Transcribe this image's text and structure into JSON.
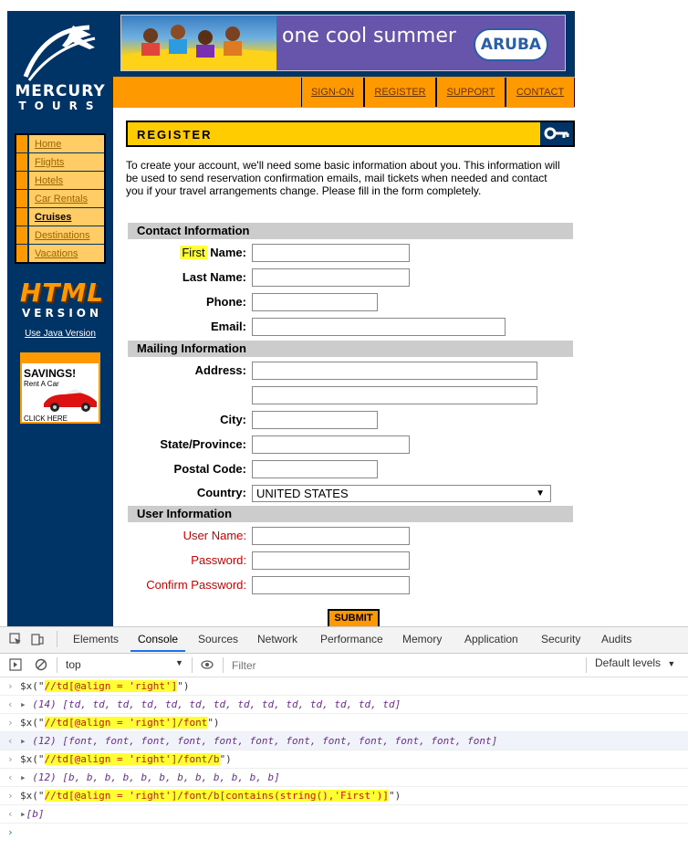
{
  "page": {
    "logo": {
      "line1": "MERCURY",
      "line2": "TOURS"
    },
    "sidebar_nav": [
      {
        "label": "Home",
        "active": false
      },
      {
        "label": "Flights",
        "active": false
      },
      {
        "label": "Hotels",
        "active": false
      },
      {
        "label": "Car Rentals",
        "active": false
      },
      {
        "label": "Cruises",
        "active": true
      },
      {
        "label": "Destinations",
        "active": false
      },
      {
        "label": "Vacations",
        "active": false
      }
    ],
    "html_badge": {
      "big": "HTML",
      "version": "VERSION"
    },
    "java_link": "Use Java Version",
    "ad": {
      "title": "SAVINGS!",
      "subtitle": "Rent A Car",
      "cta": "CLICK HERE"
    },
    "banner": {
      "slogan": "one cool summer",
      "brand": "ARUBA"
    },
    "top_nav": [
      "SIGN-ON",
      "REGISTER",
      "SUPPORT",
      "CONTACT"
    ],
    "register_title": "REGISTER",
    "intro": "To create your account, we'll need some basic information about you. This information will be used to send reservation confirmation emails, mail tickets when needed and contact you if your travel arrangements change. Please fill in the form completely.",
    "sections": {
      "contact": "Contact Information",
      "mailing": "Mailing Information",
      "user": "User Information"
    },
    "fields": {
      "first_name_highlight": "First",
      "first_name_rest": " Name:",
      "last_name": "Last Name:",
      "phone": "Phone:",
      "email": "Email:",
      "address": "Address:",
      "city": "City:",
      "state": "State/Province:",
      "postal": "Postal Code:",
      "country": "Country:",
      "country_value": "UNITED STATES",
      "user_name": "User Name:",
      "password": "Password:",
      "confirm_password": "Confirm Password:"
    },
    "submit": "SUBMIT",
    "colors": {
      "navy": "#003366",
      "orange": "#ff9900",
      "yellow": "#ffcc00",
      "red_label": "#cc0000"
    }
  },
  "devtools": {
    "tabs": [
      "Elements",
      "Console",
      "Sources",
      "Network",
      "Performance",
      "Memory",
      "Application",
      "Security",
      "Audits"
    ],
    "active_tab": "Console",
    "context": "top",
    "filter_placeholder": "Filter",
    "levels": "Default levels",
    "console": [
      {
        "kind": "input",
        "prefix": "$x(\"",
        "query": "//td[@align = 'right']",
        "suffix": "\")"
      },
      {
        "kind": "output",
        "text": "(14) [td, td, td, td, td, td, td, td, td, td, td, td, td, td]"
      },
      {
        "kind": "input",
        "prefix": "$x(\"",
        "query": "//td[@align = 'right']/font",
        "suffix": "\")"
      },
      {
        "kind": "output",
        "text": "(12) [font, font, font, font, font, font, font, font, font, font, font, font]"
      },
      {
        "kind": "input",
        "prefix": "$x(\"",
        "query": "//td[@align = 'right']/font/b",
        "suffix": "\")"
      },
      {
        "kind": "output",
        "text": "(12) [b, b, b, b, b, b, b, b, b, b, b, b]"
      },
      {
        "kind": "input",
        "prefix": "$x(\"",
        "query": "//td[@align = 'right']/font/b[contains(string(),'First')]",
        "suffix": "\")"
      },
      {
        "kind": "output",
        "text": "[b]"
      }
    ]
  }
}
